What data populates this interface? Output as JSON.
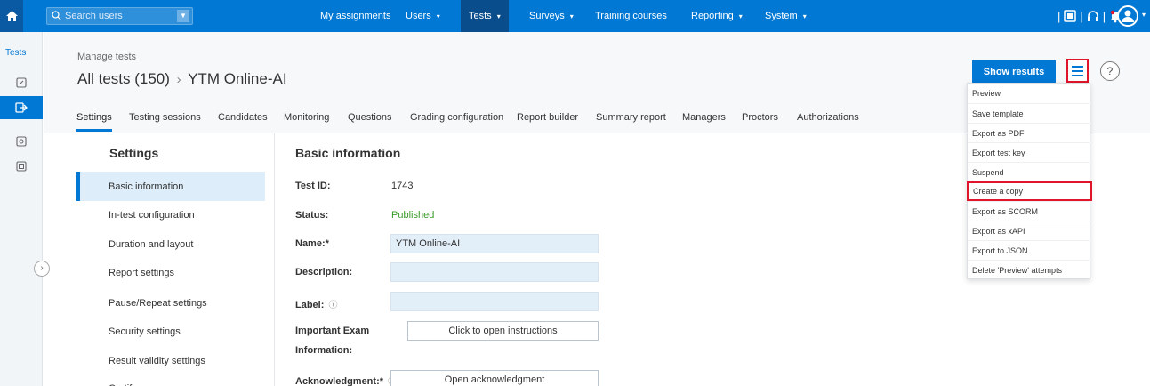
{
  "topnav": {
    "search_placeholder": "Search users",
    "items": [
      {
        "label": "My assignments",
        "caret": ""
      },
      {
        "label": "Users",
        "caret": "▾"
      },
      {
        "label": "Tests",
        "caret": "▾"
      },
      {
        "label": "Surveys",
        "caret": "▾"
      },
      {
        "label": "Training courses",
        "caret": ""
      },
      {
        "label": "Reporting",
        "caret": "▾"
      },
      {
        "label": "System",
        "caret": "▾"
      }
    ],
    "active_item": "Tests",
    "icons": [
      "home-icon",
      "search-icon",
      "help-book-icon",
      "headset-icon",
      "notification-icon",
      "avatar-icon"
    ]
  },
  "rail": {
    "title": "Tests",
    "items": [
      "edit-icon",
      "export-icon",
      "document-icon",
      "copy-icon"
    ]
  },
  "header": {
    "breadcrumb_small": "Manage tests",
    "breadcrumb_big": "All tests (150)",
    "breadcrumb_sep": "›",
    "breadcrumb_current": "YTM Online-AI",
    "show_results": "Show results",
    "help": "?",
    "tabs": [
      "Settings",
      "Testing sessions",
      "Candidates",
      "Monitoring",
      "Questions",
      "Grading configuration",
      "Report builder",
      "Summary report",
      "Managers",
      "Proctors",
      "Authorizations"
    ],
    "active_tab": "Settings"
  },
  "menu": {
    "items": [
      "Preview",
      "Save template",
      "Export as PDF",
      "Export test key",
      "Suspend",
      "Create a copy",
      "Export as SCORM",
      "Export as xAPI",
      "Export to JSON",
      "Delete 'Preview' attempts"
    ],
    "highlighted": "Create a copy"
  },
  "settings": {
    "title": "Settings",
    "items": [
      "Basic information",
      "In-test configuration",
      "Duration and layout",
      "Report settings",
      "Pause/Repeat settings",
      "Security settings",
      "Result validity settings",
      "Certif..."
    ],
    "active_item": "Basic information"
  },
  "basic_info": {
    "title": "Basic information",
    "test_id_label": "Test ID:",
    "test_id_value": "1743",
    "status_label": "Status:",
    "status_value": "Published",
    "name_label": "Name:*",
    "name_value": "YTM Online-AI",
    "description_label": "Description:",
    "description_value": "",
    "label_label": "Label:",
    "label_value": "",
    "important_label_1": "Important Exam",
    "important_label_2": "Information:",
    "instructions_button": "Click to open instructions",
    "acknowledgment_label": "Acknowledgment:*",
    "acknowledgment_button": "Open acknowledgment"
  },
  "colors": {
    "accent": "#0078d4",
    "highlight_border": "#e0142a",
    "status_published": "#3a9a2a"
  }
}
